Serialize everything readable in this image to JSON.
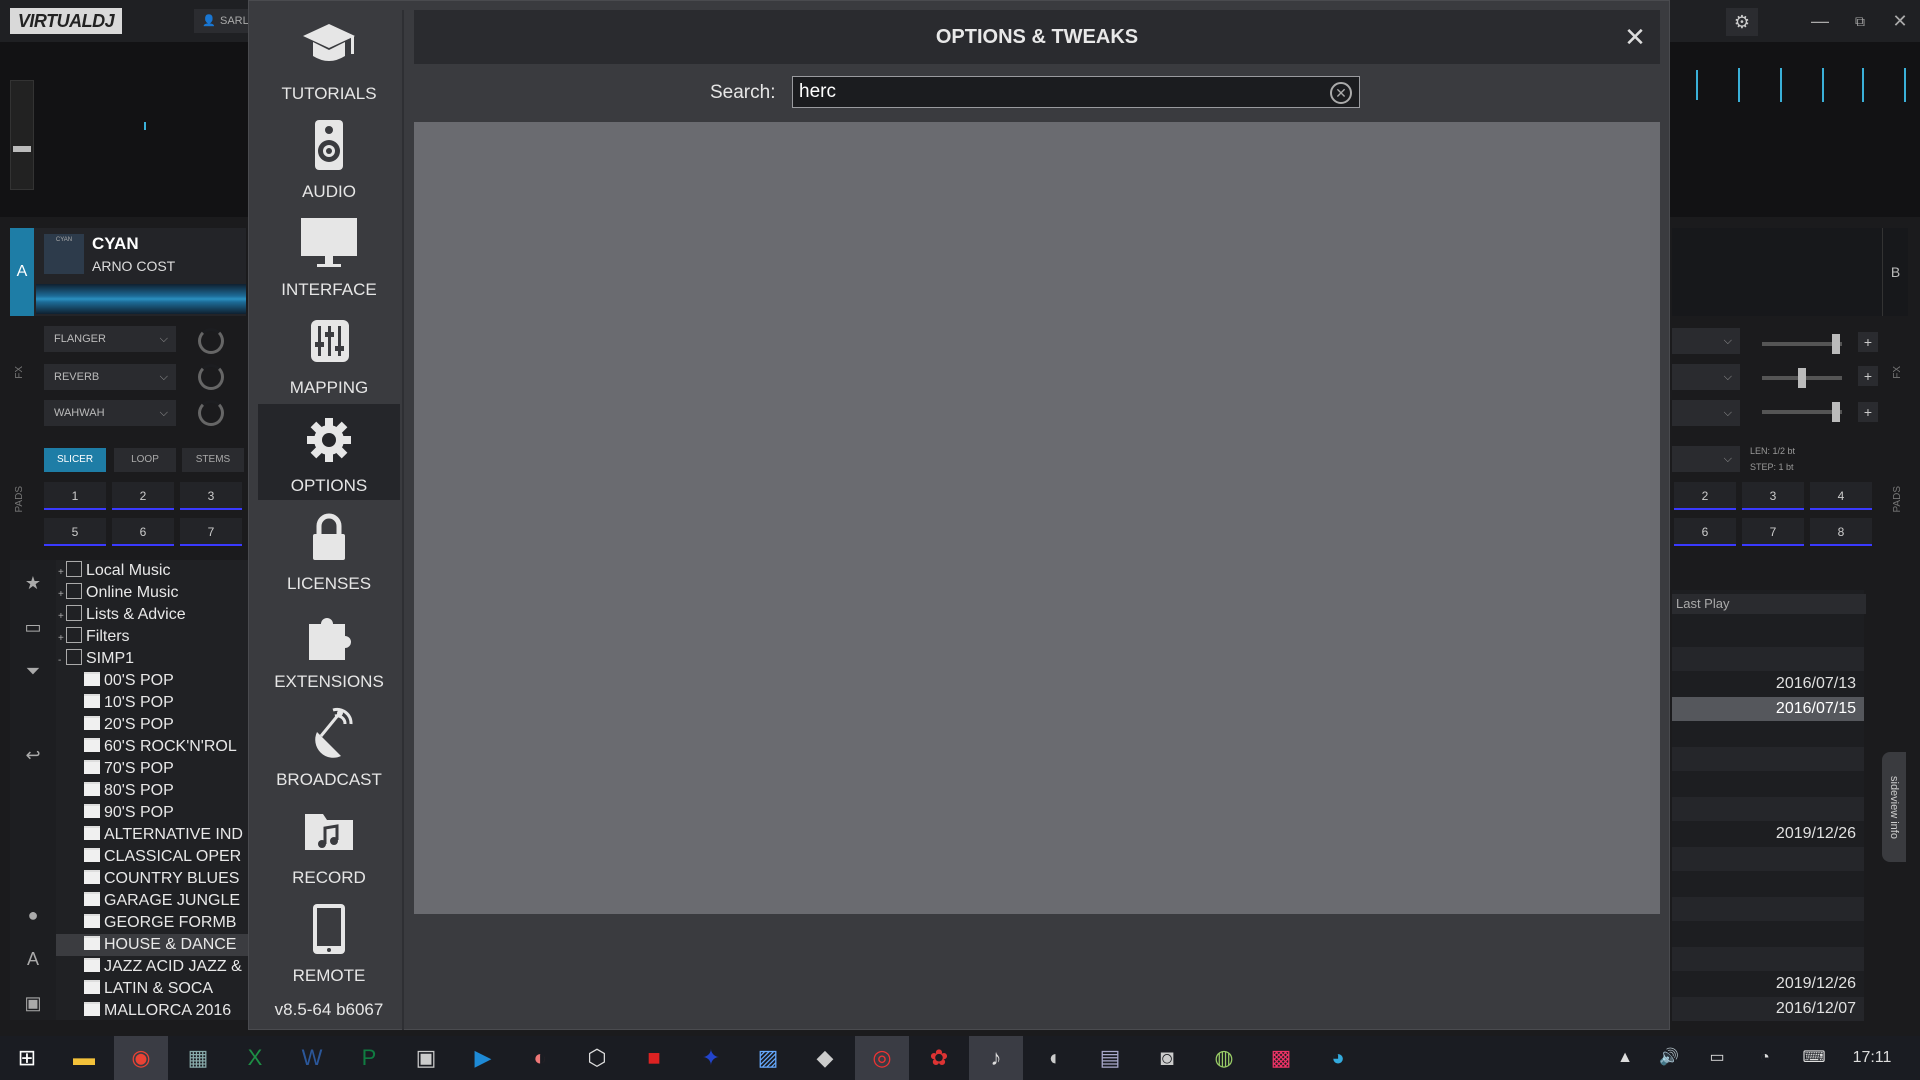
{
  "app": {
    "logo": "VIRTUALDJ",
    "user": "SARL",
    "gear": "⚙"
  },
  "deckA": {
    "letter": "A",
    "cover_text": "CYAN",
    "title": "CYAN",
    "artist": "ARNO COST"
  },
  "deckB": {
    "letter": "B"
  },
  "fx": {
    "label": "FX",
    "effects": [
      "FLANGER",
      "REVERB",
      "WAHWAH"
    ]
  },
  "pads": {
    "label": "PADS",
    "modes": [
      "SLICER",
      "LOOP",
      "STEMS"
    ],
    "left_row1": [
      "1",
      "2",
      "3"
    ],
    "left_row2": [
      "5",
      "6",
      "7"
    ],
    "right_row1": [
      "2",
      "3",
      "4"
    ],
    "right_row2": [
      "6",
      "7",
      "8"
    ],
    "len_label": "LEN: 1/2 bt",
    "step_label": "STEP: 1 bt"
  },
  "browser": {
    "tree": [
      {
        "label": "Local Music",
        "type": "root",
        "icon": "computer-icon"
      },
      {
        "label": "Online Music",
        "type": "root",
        "icon": "online-music-icon"
      },
      {
        "label": "Lists & Advice",
        "type": "root",
        "icon": "list-icon"
      },
      {
        "label": "Filters",
        "type": "root",
        "icon": "filter-icon"
      },
      {
        "label": "SIMP1",
        "type": "root-open",
        "icon": "star-folder-icon"
      },
      {
        "label": "00'S POP",
        "type": "folder"
      },
      {
        "label": "10'S POP",
        "type": "folder"
      },
      {
        "label": "20'S POP",
        "type": "folder"
      },
      {
        "label": "60'S ROCK'N'ROL",
        "type": "folder"
      },
      {
        "label": "70'S POP",
        "type": "folder"
      },
      {
        "label": "80'S POP",
        "type": "folder"
      },
      {
        "label": "90'S POP",
        "type": "folder"
      },
      {
        "label": "ALTERNATIVE IND",
        "type": "folder"
      },
      {
        "label": "CLASSICAL OPER",
        "type": "folder"
      },
      {
        "label": "COUNTRY BLUES",
        "type": "folder"
      },
      {
        "label": "GARAGE JUNGLE",
        "type": "folder"
      },
      {
        "label": "GEORGE FORMB",
        "type": "folder"
      },
      {
        "label": "HOUSE & DANCE",
        "type": "folder",
        "selected": true
      },
      {
        "label": "JAZZ ACID JAZZ &",
        "type": "folder"
      },
      {
        "label": "LATIN & SOCA",
        "type": "folder"
      },
      {
        "label": "MALLORCA 2016",
        "type": "folder"
      }
    ],
    "last_play_header": "Last Play",
    "last_play_rows": [
      "",
      "",
      "2016/07/13",
      "2016/07/15",
      "",
      "",
      "",
      "",
      "2019/12/26",
      "",
      "",
      "",
      "",
      "",
      "2019/12/26",
      "2016/12/07"
    ],
    "sideview_label": "sideview info"
  },
  "modal": {
    "title": "OPTIONS & TWEAKS",
    "close": "✕",
    "search_label": "Search:",
    "search_value": "herc",
    "version": "v8.5-64 b6067",
    "nav": [
      {
        "label": "TUTORIALS",
        "icon": "graduation-cap-icon"
      },
      {
        "label": "AUDIO",
        "icon": "speaker-icon"
      },
      {
        "label": "INTERFACE",
        "icon": "monitor-icon"
      },
      {
        "label": "MAPPING",
        "icon": "mixer-sliders-icon"
      },
      {
        "label": "OPTIONS",
        "icon": "gear-icon",
        "active": true
      },
      {
        "label": "LICENSES",
        "icon": "lock-icon"
      },
      {
        "label": "EXTENSIONS",
        "icon": "puzzle-icon"
      },
      {
        "label": "BROADCAST",
        "icon": "broadcast-icon"
      },
      {
        "label": "RECORD",
        "icon": "music-folder-icon"
      },
      {
        "label": "REMOTE",
        "icon": "tablet-icon"
      }
    ]
  },
  "taskbar": {
    "time": "17:11",
    "apps": [
      "windows-start-icon",
      "file-explorer-icon",
      "chrome-icon",
      "calculator-icon",
      "excel-icon",
      "word-icon",
      "publisher-icon",
      "app-icon",
      "powershell-icon",
      "app-icon",
      "app-icon",
      "app-icon",
      "app-icon",
      "app-icon",
      "app-icon",
      "virtualdj-icon",
      "app-icon",
      "itunes-icon",
      "app-icon",
      "app-icon",
      "app-icon",
      "app-icon",
      "app-icon",
      "app-icon"
    ]
  }
}
